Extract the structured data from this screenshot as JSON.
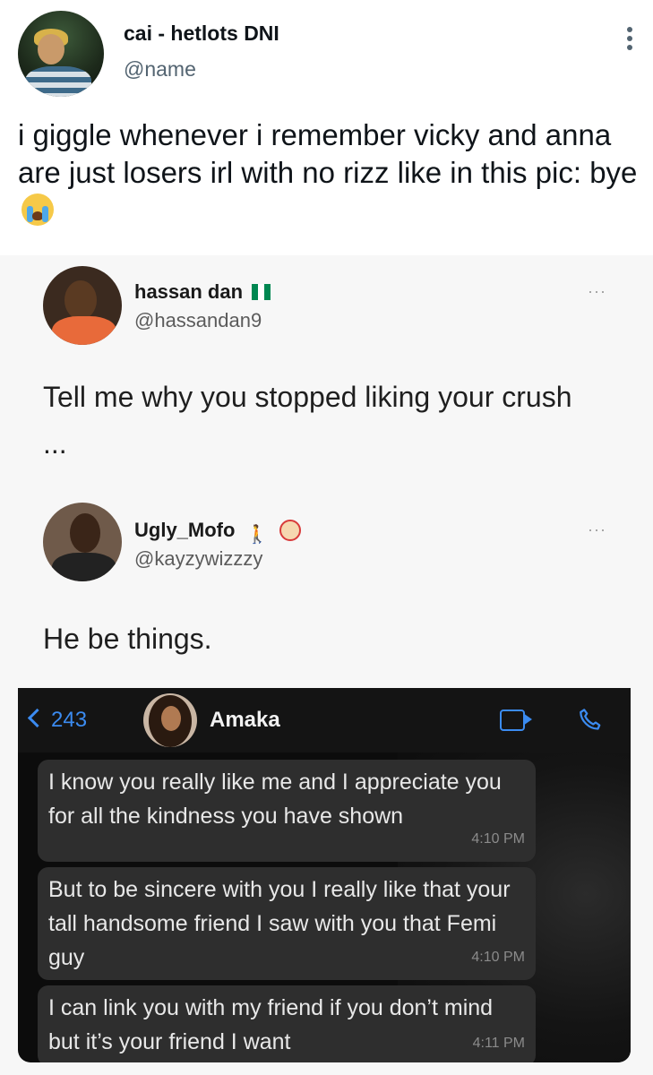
{
  "tweet": {
    "display_name": "cai - hetlots DNI",
    "handle": "@name",
    "text": "i giggle whenever i remember vicky and anna are just losers irl with no rizz like in this pic: bye",
    "emoji": "loudly-crying-face"
  },
  "embedded": {
    "post1": {
      "name": "hassan dan",
      "name_emoji": "nigeria-flag",
      "handle": "@hassandan9",
      "dots": "···",
      "text": "Tell me why you stopped liking your crush ..."
    },
    "post2": {
      "name": "Ugly_Mofo",
      "name_emojis": [
        "person-walking-with-cane",
        "clown-face"
      ],
      "handle": "@kayzywizzzy",
      "dots": "···",
      "text": "He be things."
    },
    "chat": {
      "back_count": "243",
      "contact_name": "Amaka",
      "messages": [
        {
          "text": "I know you really like me and I appreciate you for all the kindness you have shown",
          "time": "4:10 PM"
        },
        {
          "text": "But to be sincere with you I really like that your tall handsome friend I saw with you that Femi guy",
          "time": "4:10 PM"
        },
        {
          "text": "I can link you with my friend if you don’t mind but it’s your friend I want",
          "time": "4:11 PM"
        }
      ],
      "accent_color": "#3b8bf0"
    }
  },
  "colors": {
    "text": "#0f1419",
    "secondary": "#536471",
    "nigeria_green": "#008751"
  }
}
